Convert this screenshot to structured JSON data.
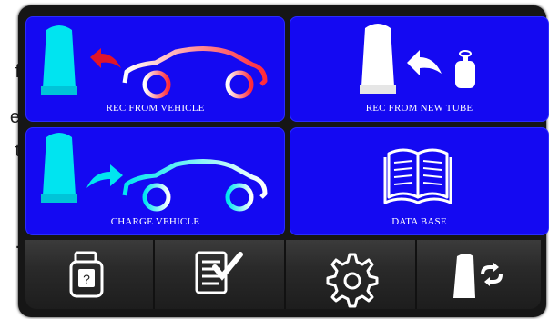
{
  "side_text": [
    "f",
    "e",
    "t",
    "."
  ],
  "tiles": {
    "rec_from_vehicle": "REC FROM VEHICLE",
    "rec_from_new_tube": "REC FROM NEW TUBE",
    "charge_vehicle": "CHARGE VEHICLE",
    "data_base": "DATA BASE"
  },
  "toolbar_icons": [
    "refrigerant-tank-icon",
    "checklist-icon",
    "settings-gear-icon",
    "machine-swap-icon"
  ],
  "colors": {
    "tile_blue": "#1409f2",
    "cyan": "#00e6f0",
    "red_arrow": "#e0152a",
    "frame": "#161616"
  }
}
